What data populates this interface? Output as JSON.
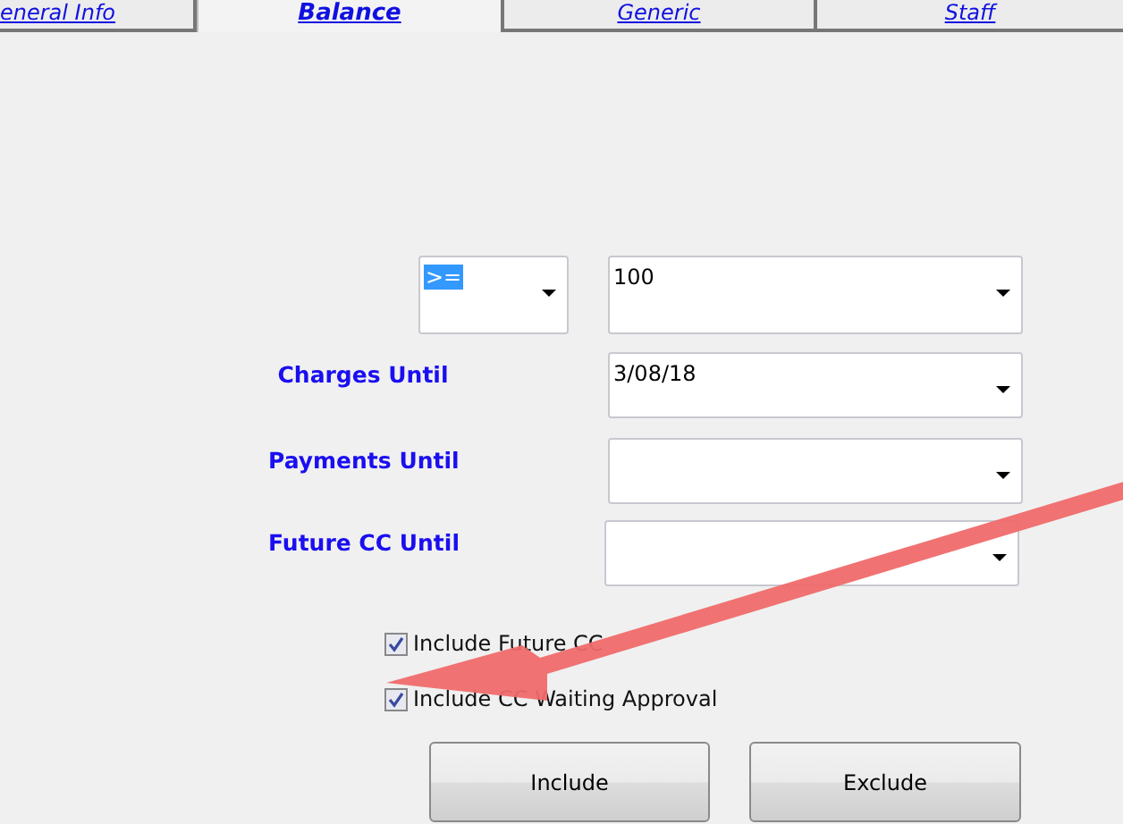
{
  "tabs": [
    {
      "label": "eneral Info",
      "selected": false
    },
    {
      "label": "Balance",
      "selected": true
    },
    {
      "label": "Generic",
      "selected": false
    },
    {
      "label": "Staff",
      "selected": false
    }
  ],
  "operator": {
    "value": ">="
  },
  "amount": {
    "value": "100"
  },
  "fields": [
    {
      "label": "Charges Until",
      "value": "3/08/18"
    },
    {
      "label": "Payments Until"
    },
    {
      "label": "Future CC Until"
    }
  ],
  "checkboxes": [
    {
      "label": "Include Future CC",
      "checked": true
    },
    {
      "label": "Include CC Waiting Approval",
      "checked": true
    }
  ],
  "buttons": [
    "Include",
    "Exclude"
  ],
  "annotation": {
    "kind": "arrow"
  }
}
